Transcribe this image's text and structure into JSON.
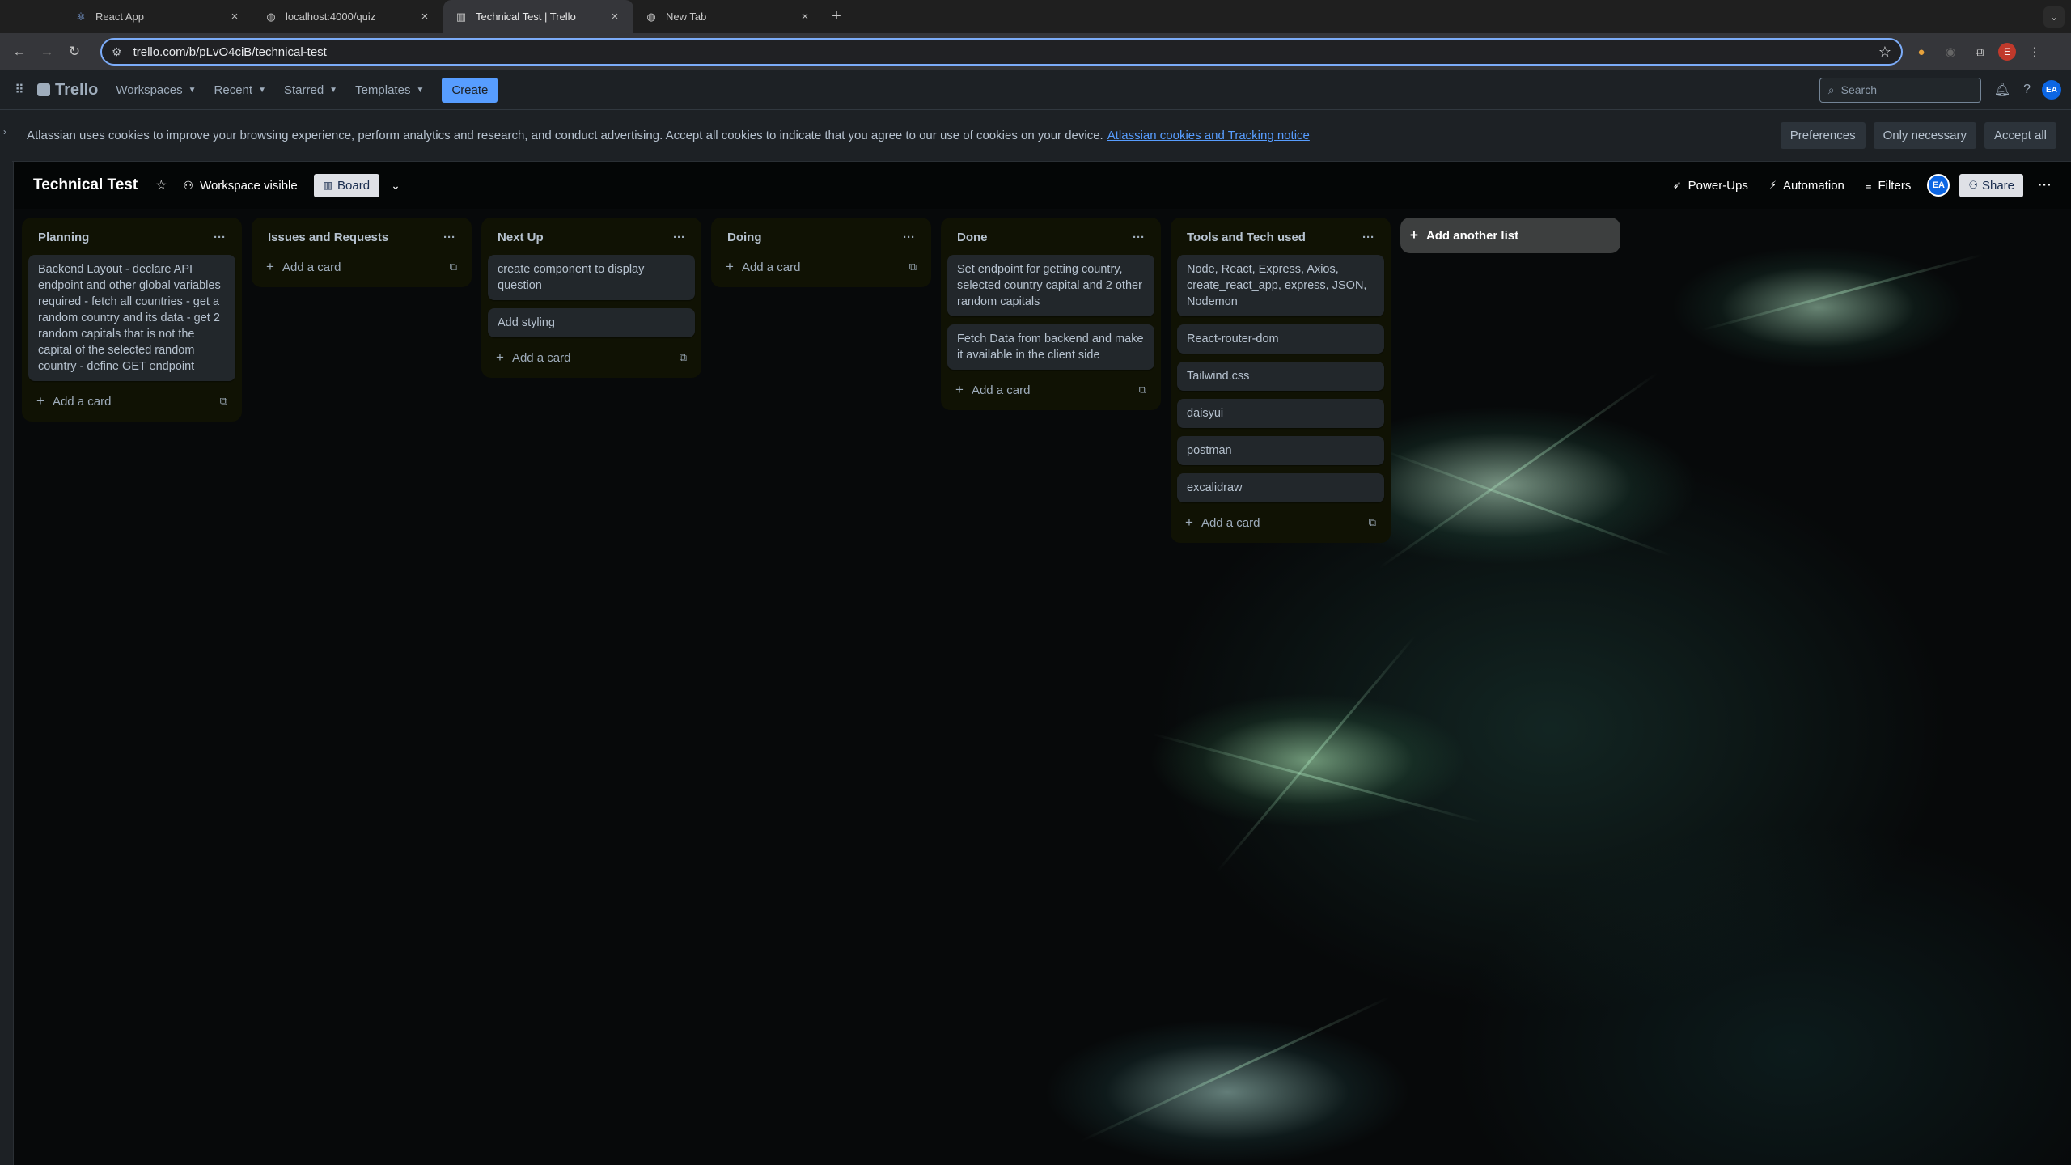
{
  "browser": {
    "tabs": [
      {
        "title": "React App",
        "icon": "react-icon"
      },
      {
        "title": "localhost:4000/quiz",
        "icon": "globe-icon"
      },
      {
        "title": "Technical Test | Trello",
        "icon": "trello-icon"
      },
      {
        "title": "New Tab",
        "icon": "globe-icon"
      }
    ],
    "url": "trello.com/b/pLvO4ciB/technical-test",
    "profile_initial": "E"
  },
  "header": {
    "logo": "Trello",
    "menus": [
      "Workspaces",
      "Recent",
      "Starred",
      "Templates"
    ],
    "create_label": "Create",
    "search_placeholder": "Search",
    "avatar_initials": "EA"
  },
  "cookie_banner": {
    "text": "Atlassian uses cookies to improve your browsing experience, perform analytics and research, and conduct advertising. Accept all cookies to indicate that you agree to our use of cookies on your device.",
    "link": "Atlassian cookies and Tracking notice",
    "buttons": [
      "Preferences",
      "Only necessary",
      "Accept all"
    ]
  },
  "board": {
    "name": "Technical Test",
    "visibility": "Workspace visible",
    "view": "Board",
    "actions": [
      "Power-Ups",
      "Automation",
      "Filters"
    ],
    "avatar_initials": "EA",
    "share_label": "Share",
    "add_list_label": "Add another list",
    "add_card_label": "Add a card",
    "lists": [
      {
        "title": "Planning",
        "cards": [
          "Backend Layout - declare API endpoint and other global variables required - fetch all countries - get a random country and its data - get 2 random capitals that is not the capital of the selected random country - define GET endpoint"
        ]
      },
      {
        "title": "Issues and Requests",
        "cards": []
      },
      {
        "title": "Next Up",
        "cards": [
          "create component to display question",
          "Add styling"
        ]
      },
      {
        "title": "Doing",
        "cards": []
      },
      {
        "title": "Done",
        "cards": [
          "Set endpoint for getting country, selected country capital and 2 other random capitals",
          "Fetch Data from backend and make it available in the client side"
        ]
      },
      {
        "title": "Tools and Tech used",
        "cards": [
          "Node, React, Express, Axios, create_react_app, express, JSON, Nodemon",
          "React-router-dom",
          "Tailwind.css",
          "daisyui",
          "postman",
          "excalidraw"
        ]
      }
    ]
  }
}
